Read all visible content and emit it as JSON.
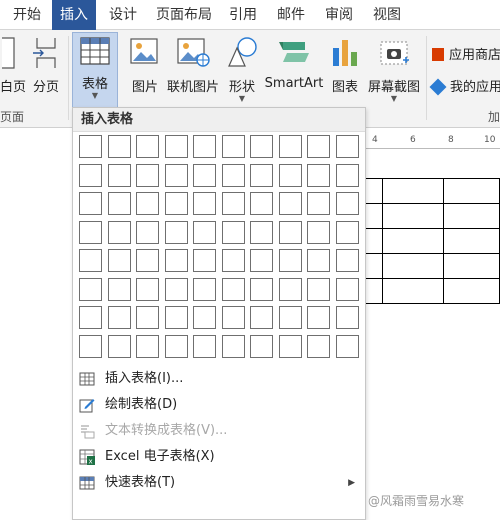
{
  "tabs": [
    "开始",
    "插入",
    "设计",
    "页面布局",
    "引用",
    "邮件",
    "审阅",
    "视图"
  ],
  "active_tab": "插入",
  "ribbon": {
    "left_buttons": {
      "blank_page_partial": "白页",
      "page_break": "分页"
    },
    "table_button": "表格",
    "picture": "图片",
    "online_picture": "联机图片",
    "shapes": "形状",
    "smartart": "SmartArt",
    "chart": "图表",
    "screenshot": "屏幕截图",
    "app_store": "应用商店",
    "my_apps": "我的应用",
    "group_pages_partial": "页面",
    "group_addins_partial": "加"
  },
  "ruler_ticks": [
    "4",
    "6",
    "8",
    "10"
  ],
  "insert_table_menu": {
    "title": "插入表格",
    "grid": {
      "columns": 10,
      "rows": 8
    },
    "items": [
      {
        "label": "插入表格(I)...",
        "icon": "table-grid-icon",
        "disabled": false,
        "submenu": false
      },
      {
        "label": "绘制表格(D)",
        "icon": "pencil-table-icon",
        "disabled": false,
        "submenu": false
      },
      {
        "label": "文本转换成表格(V)...",
        "icon": "text-to-table-icon",
        "disabled": true,
        "submenu": false
      },
      {
        "label": "Excel 电子表格(X)",
        "icon": "excel-icon",
        "disabled": false,
        "submenu": false
      },
      {
        "label": "快速表格(T)",
        "icon": "quick-table-icon",
        "disabled": false,
        "submenu": true
      }
    ]
  },
  "document_table": {
    "rows": 5,
    "columns": 3
  },
  "watermark": "@风霜雨雪易水寒",
  "colors": {
    "accent": "#2b579a",
    "table_button_highlight": "#c5d6ee",
    "app_store_icon": "#d83b01",
    "my_apps_icon": "#2b7cd3"
  }
}
